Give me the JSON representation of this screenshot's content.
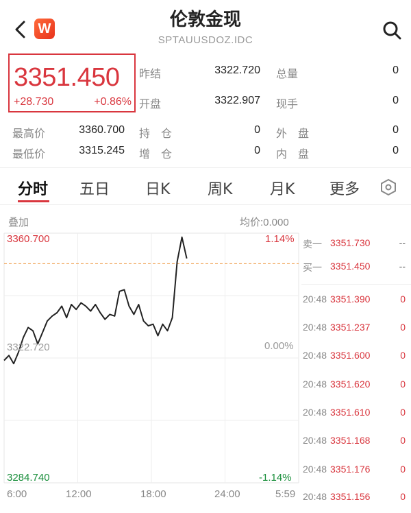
{
  "header": {
    "title": "伦敦金现",
    "code": "SPTAUUSDOZ.IDC",
    "logo_letter": "W"
  },
  "quote": {
    "price": "3351.450",
    "change": "+28.730",
    "change_pct": "+0.86%",
    "prev_close_label": "昨结",
    "prev_close": "3322.720",
    "open_label": "开盘",
    "open": "3322.907",
    "volume_label": "总量",
    "volume": "0",
    "hand_label": "现手",
    "hand": "0",
    "high_label": "最高价",
    "high": "3360.700",
    "low_label": "最低价",
    "low": "3315.245",
    "hold_label": "持　仓",
    "hold": "0",
    "add_label": "增　仓",
    "add": "0",
    "outer_label": "外　盘",
    "outer": "0",
    "inner_label": "内　盘",
    "inner": "0"
  },
  "tabs": [
    "分时",
    "五日",
    "日K",
    "周K",
    "月K",
    "更多"
  ],
  "chart": {
    "overlay_label": "叠加",
    "avg_label": "均价:0.000",
    "top_price": "3360.700",
    "mid_price": "3322.720",
    "bottom_price": "3284.740",
    "top_pct": "1.14%",
    "mid_pct": "0.00%",
    "bottom_pct": "-1.14%",
    "time_labels": [
      "6:00",
      "12:00",
      "18:00",
      "24:00",
      "5:59"
    ],
    "colors": {
      "up": "#d9363e",
      "down": "#1a8f3c",
      "line": "#222222",
      "dash": "#f0a050"
    }
  },
  "chart_data": {
    "type": "line",
    "x_range": [
      "6:00",
      "5:59"
    ],
    "ylim": [
      3284.74,
      3360.7
    ],
    "y_reference": 3322.72,
    "series": [
      {
        "values": [
          3322.0,
          3323.5,
          3321.0,
          3324.5,
          3329.0,
          3332.0,
          3331.0,
          3327.0,
          3330.5,
          3334.0,
          3335.5,
          3336.5,
          3338.5,
          3335.0,
          3339.0,
          3337.5,
          3339.5,
          3338.5,
          3337.0,
          3339.0,
          3336.5,
          3334.5,
          3336.0,
          3335.5,
          3343.0,
          3343.5,
          3338.5,
          3336.0,
          3339.0,
          3334.0,
          3332.5,
          3333.0,
          3329.5,
          3333.0,
          3331.0,
          3335.0,
          3352.0,
          3359.5,
          3353.0
        ]
      }
    ]
  },
  "order_book": {
    "ask_label": "卖一",
    "ask_price": "3351.730",
    "ask_vol": "--",
    "bid_label": "买一",
    "bid_price": "3351.450",
    "bid_vol": "--"
  },
  "ticks": [
    {
      "time": "20:48",
      "price": "3351.390",
      "vol": "0"
    },
    {
      "time": "20:48",
      "price": "3351.237",
      "vol": "0"
    },
    {
      "time": "20:48",
      "price": "3351.600",
      "vol": "0"
    },
    {
      "time": "20:48",
      "price": "3351.620",
      "vol": "0"
    },
    {
      "time": "20:48",
      "price": "3351.610",
      "vol": "0"
    },
    {
      "time": "20:48",
      "price": "3351.168",
      "vol": "0"
    },
    {
      "time": "20:48",
      "price": "3351.176",
      "vol": "0"
    },
    {
      "time": "20:48",
      "price": "3351.156",
      "vol": "0"
    }
  ]
}
